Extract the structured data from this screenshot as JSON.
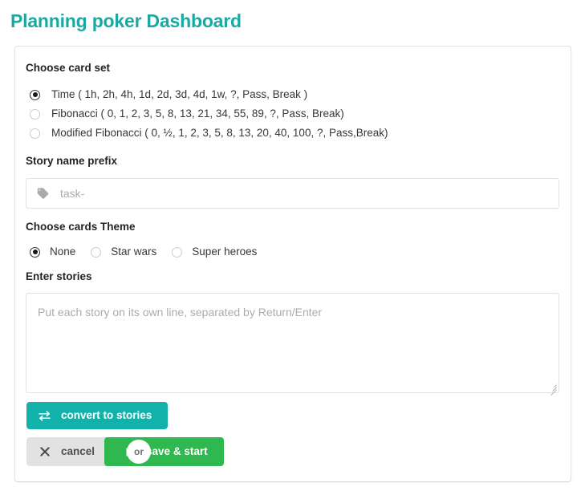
{
  "page": {
    "title": "Planning poker Dashboard",
    "title_color": "#1aa8a2"
  },
  "card_set": {
    "label": "Choose card set",
    "options": [
      {
        "label": "Time ( 1h, 2h, 4h, 1d, 2d, 3d, 4d, 1w, ?, Pass, Break )",
        "selected": true
      },
      {
        "label": "Fibonacci ( 0, 1, 2, 3, 5, 8, 13, 21, 34, 55, 89, ?, Pass, Break)",
        "selected": false
      },
      {
        "label": "Modified Fibonacci ( 0, ½, 1, 2, 3, 5, 8, 13, 20, 40, 100, ?, Pass,Break)",
        "selected": false
      }
    ]
  },
  "story_prefix": {
    "label": "Story name prefix",
    "icon": "tag-icon",
    "value": "",
    "placeholder": "task-"
  },
  "theme": {
    "label": "Choose cards Theme",
    "options": [
      {
        "label": "None",
        "selected": true
      },
      {
        "label": "Star wars",
        "selected": false
      },
      {
        "label": "Super heroes",
        "selected": false
      }
    ]
  },
  "stories": {
    "label": "Enter stories",
    "value": "",
    "placeholder": "Put each story on its own line, separated by Return/Enter"
  },
  "buttons": {
    "convert": {
      "label": "convert to stories",
      "icon": "exchange-icon",
      "color": "#12b2ab"
    },
    "cancel": {
      "label": "cancel",
      "icon": "close-icon",
      "color": "#e2e2e2"
    },
    "separator": "or",
    "save": {
      "label": "save & start",
      "icon": "play-icon",
      "color": "#2fb84f"
    }
  }
}
